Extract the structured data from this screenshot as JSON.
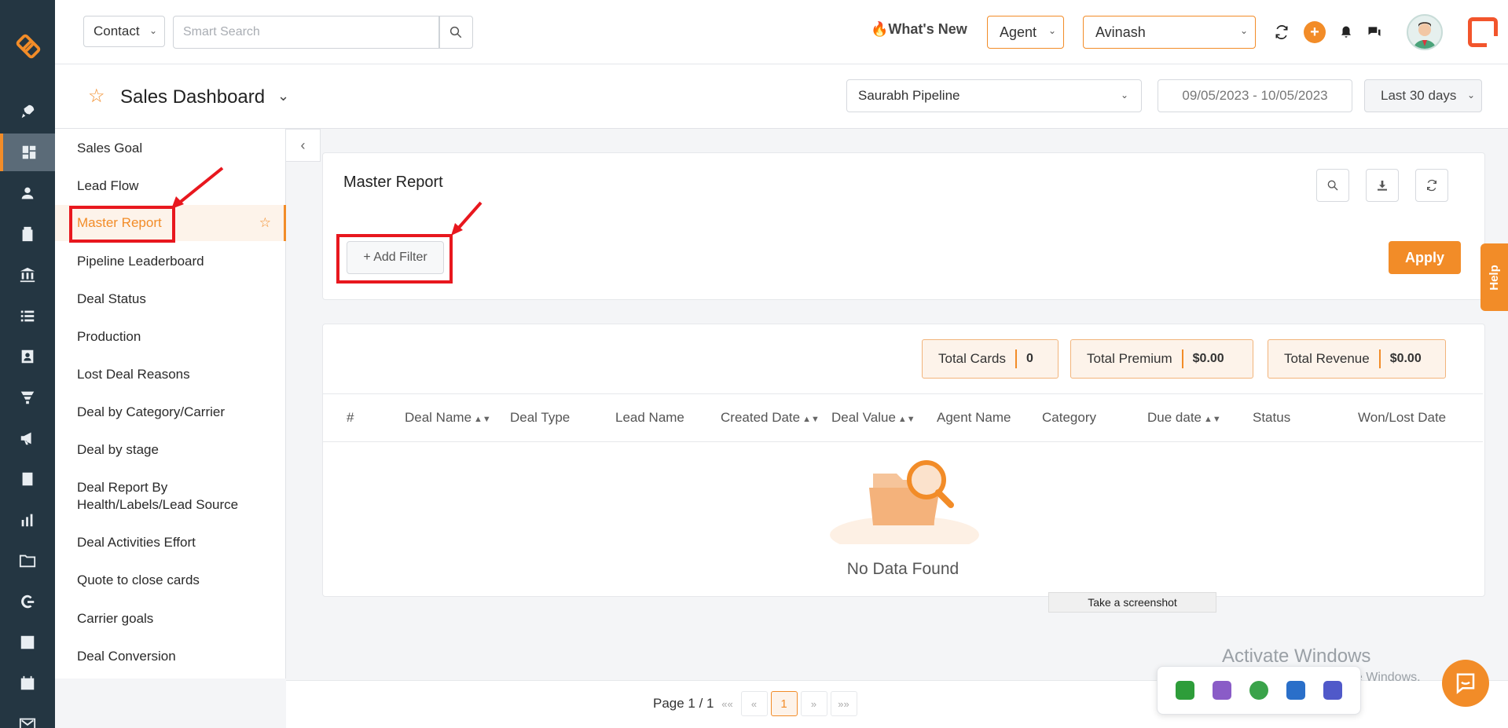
{
  "topbar": {
    "contact_select": "Contact",
    "search_placeholder": "Smart Search",
    "whats_new": "What's New",
    "whats_new_emoji": "🔥",
    "agent_select": "Agent",
    "user_select": "Avinash"
  },
  "subheader": {
    "title": "Sales Dashboard",
    "pipeline": "Saurabh Pipeline",
    "date_range": "09/05/2023 - 10/05/2023",
    "period": "Last 30 days"
  },
  "report_nav": {
    "items": [
      {
        "label": "Sales Goal"
      },
      {
        "label": "Lead Flow"
      },
      {
        "label": "Master Report"
      },
      {
        "label": "Pipeline Leaderboard"
      },
      {
        "label": "Deal Status"
      },
      {
        "label": "Production"
      },
      {
        "label": "Lost Deal Reasons"
      },
      {
        "label": "Deal by Category/Carrier"
      },
      {
        "label": "Deal by stage"
      },
      {
        "label": "Deal Report By Health/Labels/Lead Source"
      },
      {
        "label": "Deal Activities Effort"
      },
      {
        "label": "Quote to close cards"
      },
      {
        "label": "Carrier goals"
      },
      {
        "label": "Deal Conversion"
      }
    ]
  },
  "report": {
    "heading": "Master Report",
    "add_filter": "+ Add Filter",
    "apply": "Apply",
    "stats": [
      {
        "label": "Total Cards",
        "value": "0"
      },
      {
        "label": "Total Premium",
        "value": "$0.00"
      },
      {
        "label": "Total Revenue",
        "value": "$0.00"
      }
    ],
    "columns": [
      "#",
      "Deal Name",
      "Deal Type",
      "Lead Name",
      "Created Date",
      "Deal Value",
      "Agent Name",
      "Category",
      "Due date",
      "Status",
      "Won/Lost Date"
    ],
    "empty_text": "No Data Found"
  },
  "pager": {
    "text": "Page 1 / 1",
    "first": "««",
    "prev": "«",
    "current": "1",
    "next": "»",
    "last": "»»"
  },
  "overlay": {
    "screenshot_tip": "Take a screenshot",
    "activate_title": "Activate Windows",
    "activate_sub": "Go to Settings to activate Windows.",
    "help": "Help"
  },
  "colors": {
    "accent": "#f28c28",
    "rail": "#243642",
    "highlight": "#e8171e"
  }
}
